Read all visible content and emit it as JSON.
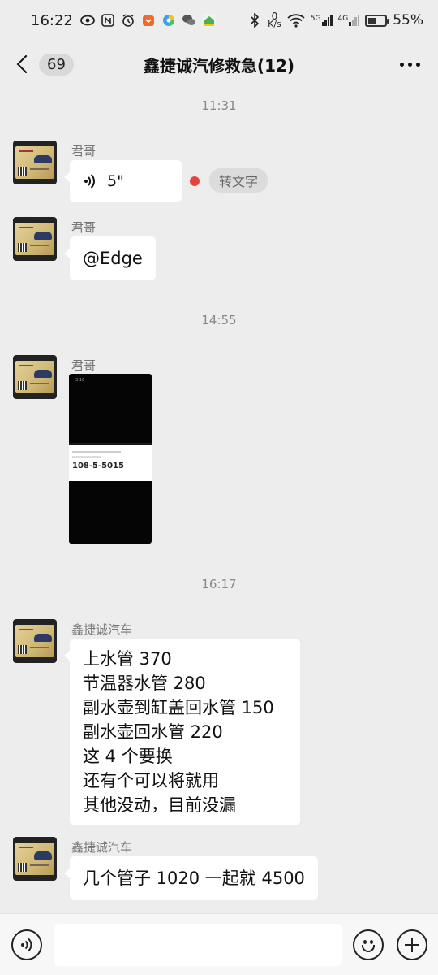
{
  "status_bar": {
    "time": "16:22",
    "network_speed_value": "0",
    "network_speed_unit": "K/s",
    "sig1_label": "5G",
    "sig2_label": "4G",
    "battery": "55%",
    "battery_level": 0.55,
    "icons": [
      "eye-icon",
      "nfc-icon",
      "alarm-icon",
      "shopping-icon",
      "browser-icon",
      "wechat-icon",
      "home-app-icon",
      "bluetooth-icon",
      "wifi-icon",
      "signal-icon",
      "battery-icon"
    ]
  },
  "header": {
    "back_count": "69",
    "title": "鑫捷诚汽修救急(12)"
  },
  "timestamps": [
    "11:31",
    "14:55",
    "16:17"
  ],
  "messages": [
    {
      "sender": "君哥",
      "type": "voice",
      "duration": "5\"",
      "to_text_label": "转文字",
      "unread": true
    },
    {
      "sender": "君哥",
      "type": "text",
      "text": "@Edge"
    },
    {
      "sender": "君哥",
      "type": "image",
      "image": {
        "phone_number": "108-5-5015",
        "status_time": "3:16"
      }
    },
    {
      "sender": "鑫捷诚汽车",
      "type": "text",
      "lines": [
        "上水管 370",
        "节温器水管 280",
        "副水壶到缸盖回水管 150",
        "副水壶回水管 220",
        "这 4 个要换",
        "还有个可以将就用",
        "其他没动，目前没漏"
      ]
    },
    {
      "sender": "鑫捷诚汽车",
      "type": "text",
      "text": "几个管子 1020 一起就 4500"
    }
  ],
  "input_bar": {
    "placeholder": "",
    "icons": [
      "voice-input-icon",
      "emoji-icon",
      "plus-icon"
    ]
  }
}
